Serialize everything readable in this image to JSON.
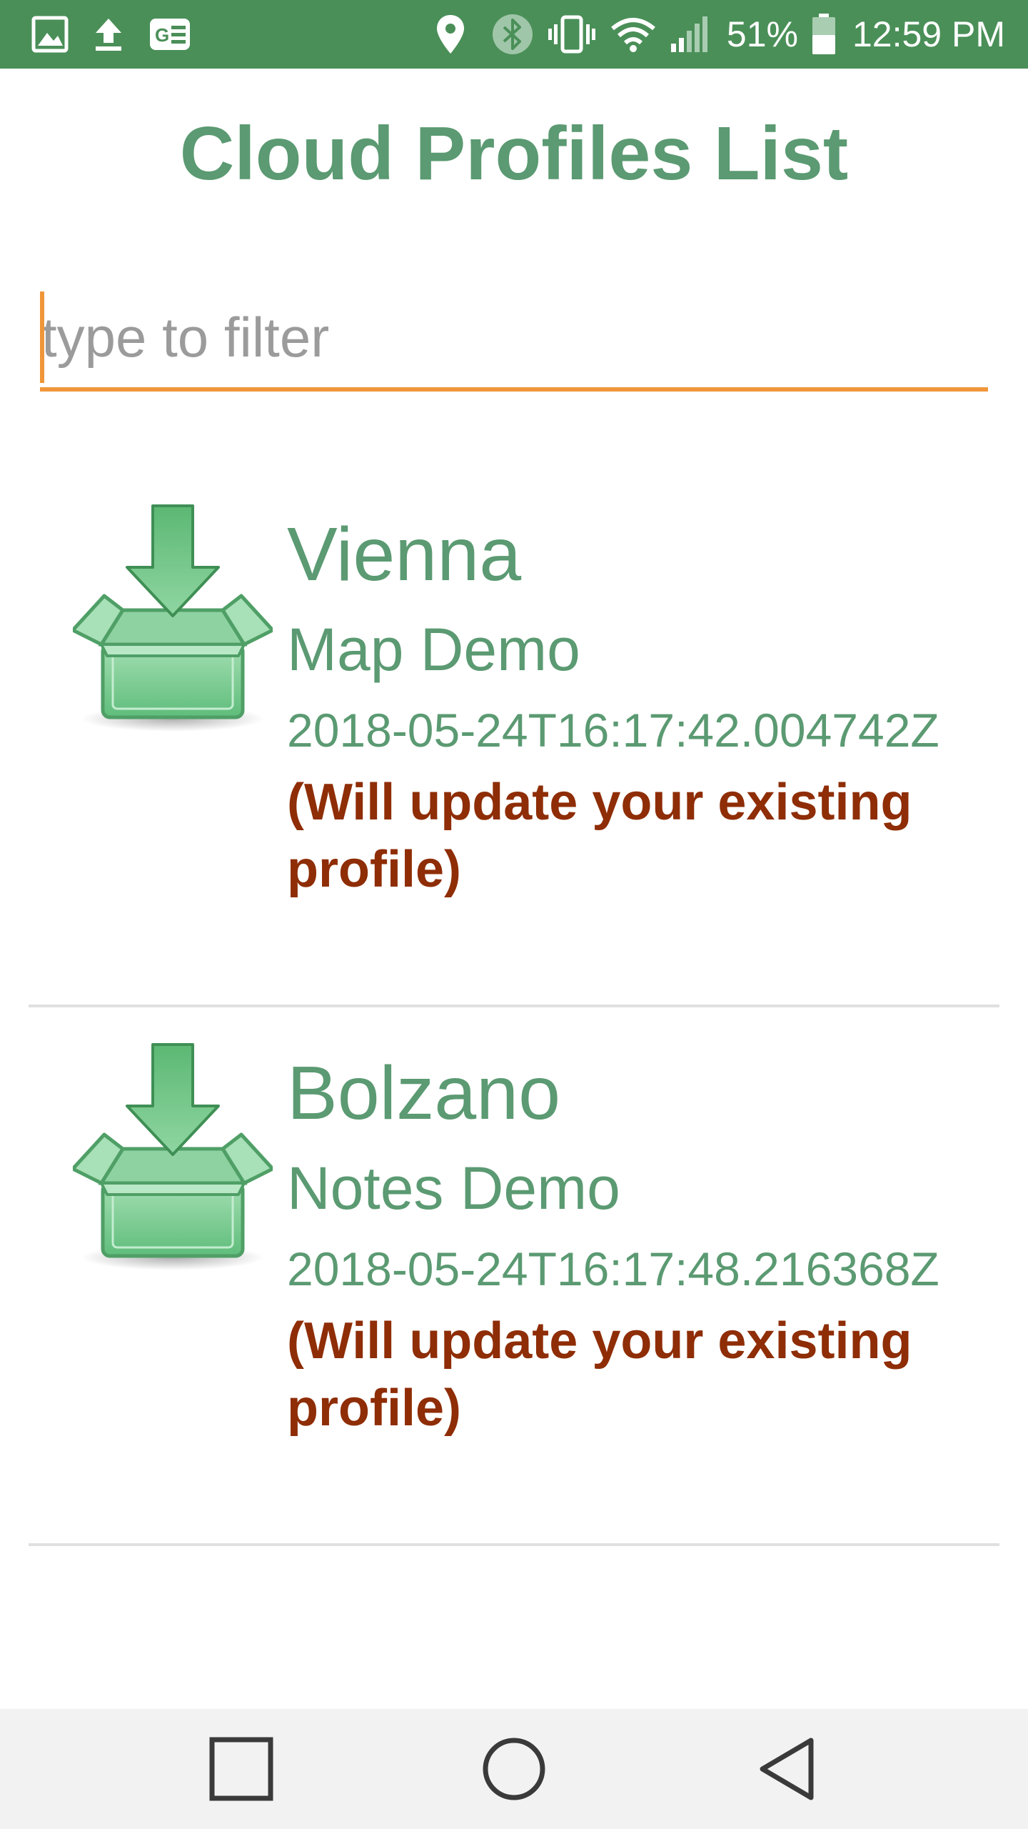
{
  "status_bar": {
    "background_color": "#4a8f58",
    "left_icons": [
      "gallery-icon",
      "upload-icon",
      "ge-app-icon"
    ],
    "right_icons": [
      "location-pin-icon",
      "bluetooth-icon",
      "vibrate-icon",
      "wifi-icon",
      "signal-icon",
      "battery-icon"
    ],
    "battery_percent": "51%",
    "time": "12:59 PM"
  },
  "page": {
    "title": "Cloud Profiles List"
  },
  "filter": {
    "placeholder": "type to filter",
    "value": "",
    "accent_color": "#f0963a"
  },
  "profiles": [
    {
      "name": "Vienna",
      "description": "Map Demo",
      "timestamp": "2018-05-24T16:17:42.004742Z",
      "warning": "(Will update your existing profile)",
      "icon": "download-box-icon"
    },
    {
      "name": "Bolzano",
      "description": "Notes Demo",
      "timestamp": "2018-05-24T16:17:48.216368Z",
      "warning": "(Will update your existing profile)",
      "icon": "download-box-icon"
    }
  ],
  "colors": {
    "primary_text": "#5b9a72",
    "warning_text": "#8e2d06",
    "divider": "#e0e0e0"
  },
  "nav_bar": {
    "buttons": [
      "recents-icon",
      "home-icon",
      "back-icon"
    ]
  }
}
